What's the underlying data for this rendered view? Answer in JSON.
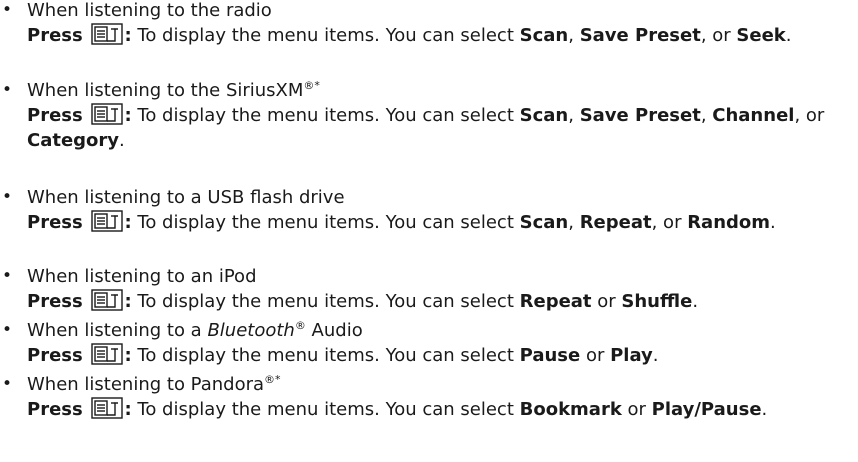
{
  "press_label": "Press",
  "description": "To display the menu items. You can select",
  "items": [
    {
      "condition": "When listening to the radio",
      "options": [
        "Scan",
        "Save Preset"
      ],
      "final_option": "Seek"
    },
    {
      "condition": "When listening to the SiriusXM",
      "condition_suffix": "®*",
      "options": [
        "Scan",
        "Save Preset",
        "Channel"
      ],
      "final_option": "Category"
    },
    {
      "condition": "When listening to a USB flash drive",
      "options": [
        "Scan",
        "Repeat"
      ],
      "final_option": "Random"
    },
    {
      "condition": "When listening to an iPod",
      "options": [
        "Repeat"
      ],
      "final_option": "Shuffle"
    },
    {
      "condition_prefix": "When listening to a ",
      "condition_italic": "Bluetooth",
      "condition_sup": "®",
      "condition_tail": " Audio",
      "options": [
        "Pause"
      ],
      "final_option": "Play"
    },
    {
      "condition": "When listening to Pandora",
      "condition_suffix": "®*",
      "options": [
        "Bookmark"
      ],
      "final_option": "Play/Pause"
    }
  ],
  "separators": {
    "comma": ", ",
    "or": " or ",
    "final_comma_or": ", or ",
    "period": "."
  },
  "icons": {
    "menu": "menu-button-icon"
  },
  "colors": {
    "text": "#1a1a1a",
    "icon": "#1a1a1a"
  }
}
